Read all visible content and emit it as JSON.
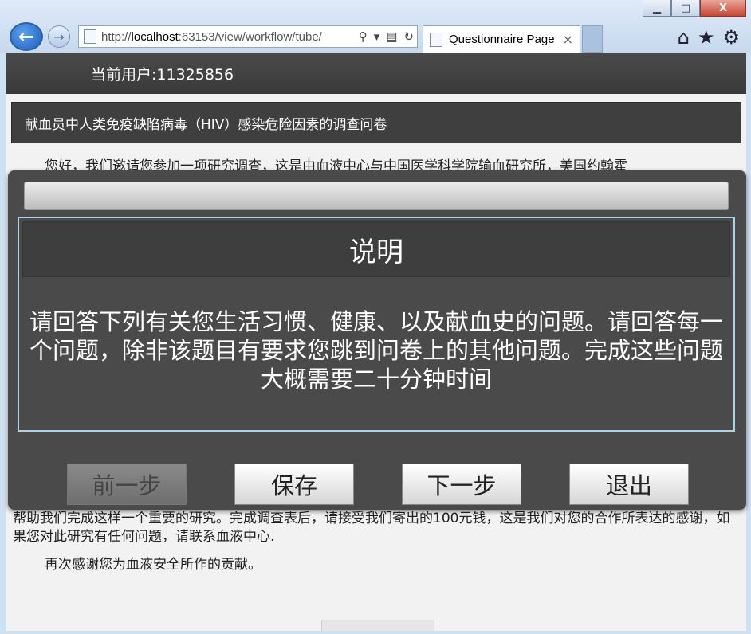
{
  "browser": {
    "address_prefix": "http://",
    "address_host": "localhost",
    "address_rest": ":63153/view/workflow/tube/",
    "tab_title": "Questionnaire Page",
    "tab_close": "×",
    "min_label": "▁",
    "max_label": "□",
    "close_label": "X",
    "back_glyph": "←",
    "forward_glyph": "→"
  },
  "header": {
    "current_user": "当前用户:11325856"
  },
  "questionnaire": {
    "title": "献血员中人类免疫缺陷病毒（HIV）感染危险因素的调查问卷",
    "intro_partial": "您好，我们邀请您参加一项研究调查，这是由血液中心与中国医学科学院输血研究所，美国约翰霍",
    "para2": "帮助我们完成这样一个重要的研究。完成调查表后，请接受我们寄出的100元钱，这是我们对您的合作所表达的感谢，如果您对此研究有任何问题，请联系血液中心.",
    "para3": "再次感谢您为血液安全所作的贡献。"
  },
  "modal": {
    "heading": "说明",
    "body": "请回答下列有关您生活习惯、健康、以及献血史的问题。请回答每一个问题，除非该题目有要求您跳到问卷上的其他问题。完成这些问题大概需要二十分钟时间",
    "buttons": {
      "prev": "前一步",
      "save": "保存",
      "next": "下一步",
      "exit": "退出"
    }
  }
}
